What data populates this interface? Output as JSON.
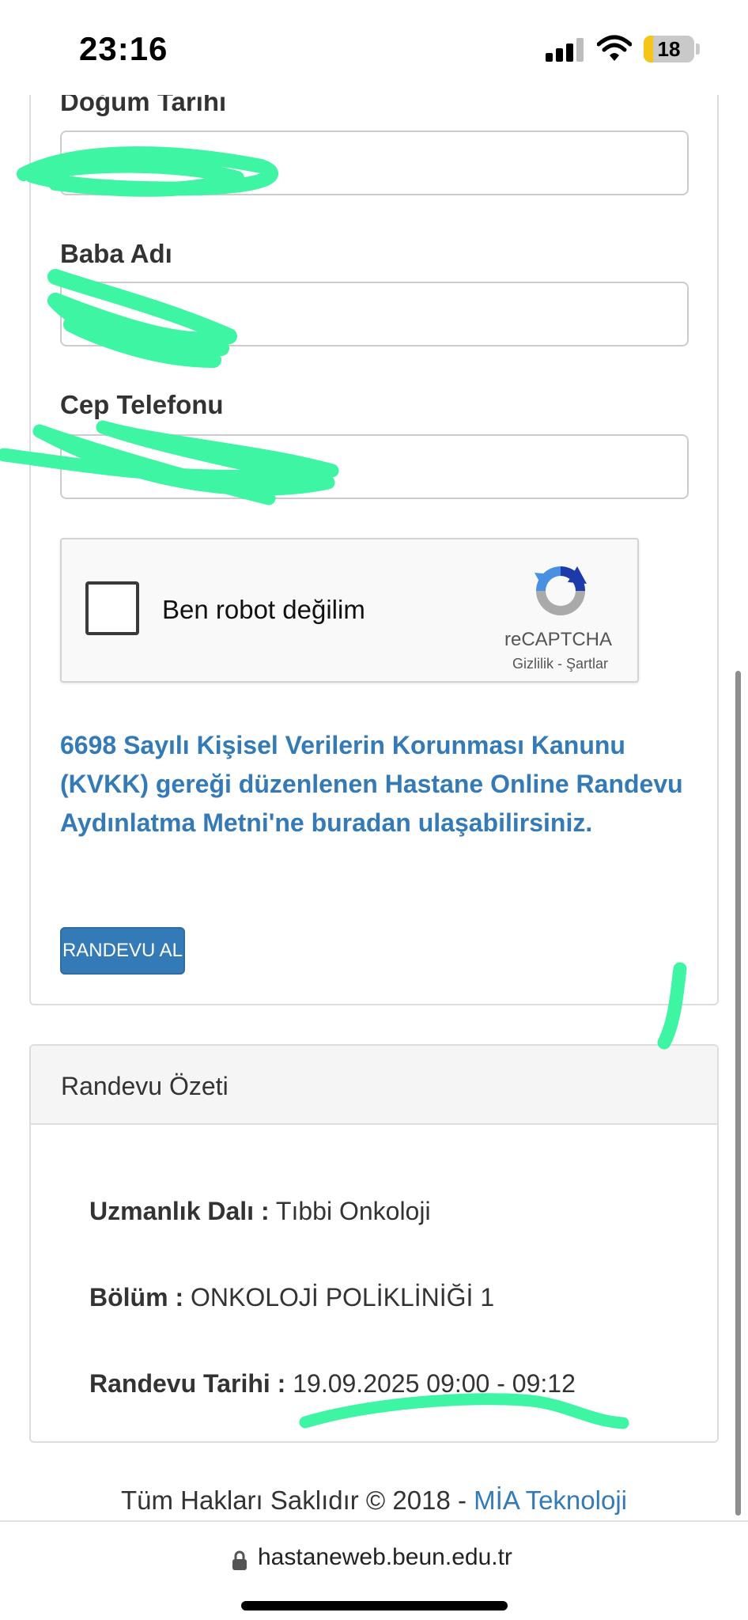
{
  "status_bar": {
    "time": "23:16",
    "battery_percent": "18",
    "battery_level": 0.18
  },
  "form": {
    "fields": [
      {
        "label": "Doğum Tarihi"
      },
      {
        "label": "Baba Adı"
      },
      {
        "label": "Cep Telefonu"
      }
    ],
    "recaptcha": {
      "label": "Ben robot değilim",
      "brand": "reCAPTCHA",
      "privacy": "Gizlilik",
      "separator": "-",
      "terms": "Şartlar"
    },
    "kvkk_link": "6698 Sayılı Kişisel Verilerin Korunması Kanunu (KVKK) gereği düzenlenen Hastane Online Randevu Aydınlatma Metni'ne buradan ulaşabilirsiniz.",
    "submit_label": "RANDEVU AL"
  },
  "summary": {
    "title": "Randevu Özeti",
    "rows": [
      {
        "label": "Uzmanlık Dalı :",
        "value": "Tıbbi Onkoloji"
      },
      {
        "label": "Bölüm :",
        "value": "ONKOLOJİ POLİKLİNİĞİ 1"
      },
      {
        "label": "Randevu Tarihi :",
        "value": "19.09.2025 09:00 - 09:12"
      }
    ]
  },
  "footer": {
    "text": "Tüm Hakları Saklıdır © 2018 - ",
    "link": "MİA Teknoloji"
  },
  "browser": {
    "url": "hastaneweb.beun.edu.tr"
  },
  "colors": {
    "link_blue": "#337ab7",
    "highlighter": "#3df5a2",
    "battery_yellow": "#f5c518"
  }
}
